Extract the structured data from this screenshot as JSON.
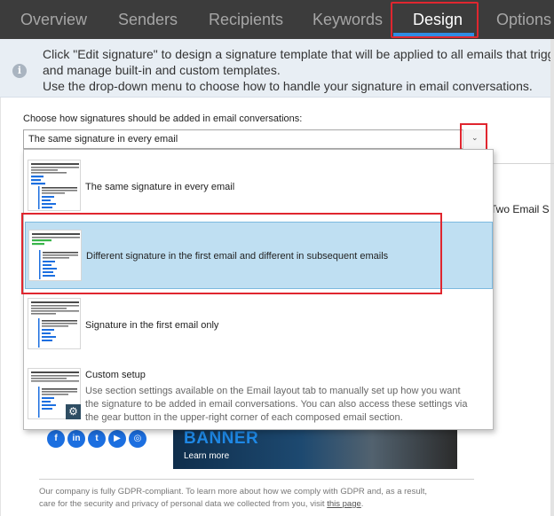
{
  "tabs": [
    {
      "label": "Overview",
      "active": false
    },
    {
      "label": "Senders",
      "active": false
    },
    {
      "label": "Recipients",
      "active": false
    },
    {
      "label": "Keywords",
      "active": false
    },
    {
      "label": "Design",
      "active": true
    },
    {
      "label": "Options",
      "active": false
    }
  ],
  "info": {
    "lines": [
      "Click \"Edit signature\" to design a signature template that will be applied to all emails that trigger th",
      "and manage built-in and custom templates.",
      "Use the drop-down menu to choose how to handle your signature in email conversations."
    ]
  },
  "combo": {
    "label": "Choose how signatures should be added in email conversations:",
    "value": "The same signature in every email"
  },
  "dropdown": {
    "options": [
      {
        "label": "The same signature in every email",
        "selected": false
      },
      {
        "label": "Different signature in the first email and different in subsequent emails",
        "selected": true
      },
      {
        "label": "Signature in the first email only",
        "selected": false
      },
      {
        "label": "Custom setup",
        "selected": false,
        "description": [
          "Use section settings available on the Email layout tab to manually set up how you want",
          "the signature to be added in email conversations. You can also access these settings via",
          "the gear button in the upper-right corner of each composed email section."
        ]
      }
    ]
  },
  "background": {
    "partial_text": "Two Email S",
    "social_icons": [
      {
        "name": "facebook-icon",
        "glyph": "f"
      },
      {
        "name": "linkedin-icon",
        "glyph": "in"
      },
      {
        "name": "twitter-icon",
        "glyph": "t"
      },
      {
        "name": "youtube-icon",
        "glyph": "▶"
      },
      {
        "name": "instagram-icon",
        "glyph": "◎"
      }
    ],
    "banner": {
      "title": "BANNER",
      "cta": "Learn more"
    },
    "footer": {
      "line1": "Our company is fully GDPR-compliant. To learn more about how we comply with GDPR and, as a result,",
      "line2": "care for the security and privacy of personal data we collected from you, visit ",
      "link": "this page",
      "line2_end": "."
    }
  },
  "colors": {
    "tabbar_bg": "#3c3c3c",
    "active_underline": "#2f8de4",
    "highlight_red": "#e0262f",
    "selected_bg": "#bfdff2",
    "info_bg": "#e8eef4"
  }
}
